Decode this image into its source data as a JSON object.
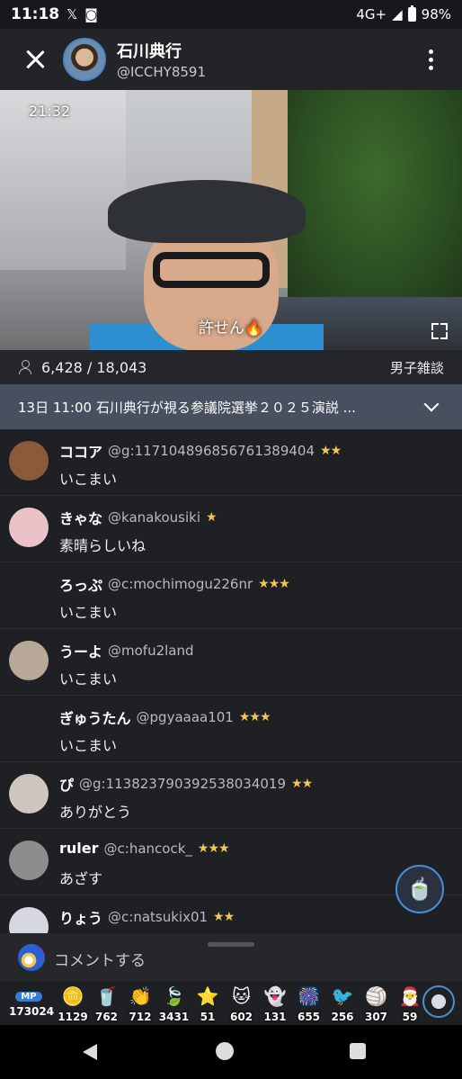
{
  "status_bar": {
    "time": "11:18",
    "network": "4G+",
    "battery": "98%"
  },
  "header": {
    "name": "石川典行",
    "handle": "@ICCHY8591"
  },
  "video": {
    "timestamp": "21:32",
    "caption": "許せん🔥"
  },
  "stats": {
    "viewers": "6,428 / 18,043",
    "category": "男子雑談"
  },
  "notice": {
    "text": "13日 11:00 石川典行が視る参議院選挙２０２５演説 ..."
  },
  "comments": [
    {
      "name": "ココア",
      "handle": "@g:117104896856761389404",
      "badges": "★★",
      "text": "いこまい",
      "avatar_color": "#8a5a3a",
      "has_avatar": true
    },
    {
      "name": "きゃな",
      "handle": "@kanakousiki",
      "badges": "★",
      "text": "素晴らしいね",
      "avatar_color": "#e9c3c8",
      "has_avatar": true
    },
    {
      "name": "ろっぷ",
      "handle": "@c:mochimogu226nr",
      "badges": "★★★",
      "text": "いこまい",
      "avatar_color": "",
      "has_avatar": false
    },
    {
      "name": "うーよ",
      "handle": "@mofu2land",
      "badges": "",
      "text": "いこまい",
      "avatar_color": "#b8a89a",
      "has_avatar": true
    },
    {
      "name": "ぎゅうたん",
      "handle": "@pgyaaaa101",
      "badges": "★★★",
      "text": "いこまい",
      "avatar_color": "",
      "has_avatar": false
    },
    {
      "name": "ぴ",
      "handle": "@g:113823790392538034019",
      "badges": "★★",
      "text": "ありがとう",
      "avatar_color": "#cfc6be",
      "has_avatar": true
    },
    {
      "name": "ruler",
      "handle": "@c:hancock_",
      "badges": "★★★",
      "text": "あざす",
      "avatar_color": "#8d8d8d",
      "has_avatar": true
    },
    {
      "name": "りょう",
      "handle": "@c:natsukix01",
      "badges": "★★",
      "text": "",
      "avatar_color": "#d6d8e0",
      "has_avatar": true
    }
  ],
  "comment_input": {
    "placeholder": "コメントする"
  },
  "gifts": {
    "mp_label": "MP",
    "mp_value": "173024",
    "items": [
      {
        "icon": "coin-icon",
        "glyph": "🪙",
        "count": "1129"
      },
      {
        "icon": "drink-icon",
        "glyph": "🥤",
        "count": "762"
      },
      {
        "icon": "clap-icon",
        "glyph": "👏",
        "count": "712"
      },
      {
        "icon": "leaf-icon",
        "glyph": "🍃",
        "count": "3431"
      },
      {
        "icon": "star-icon",
        "glyph": "⭐",
        "count": "51"
      },
      {
        "icon": "cat-icon",
        "glyph": "🐱",
        "count": "602"
      },
      {
        "icon": "ghost-icon",
        "glyph": "👻",
        "count": "131"
      },
      {
        "icon": "firework-icon",
        "glyph": "🎆",
        "count": "655"
      },
      {
        "icon": "bird-icon",
        "glyph": "🐦",
        "count": "256"
      },
      {
        "icon": "ball-icon",
        "glyph": "🏐",
        "count": "307"
      },
      {
        "icon": "santa-icon",
        "glyph": "🎅",
        "count": "59"
      }
    ]
  }
}
